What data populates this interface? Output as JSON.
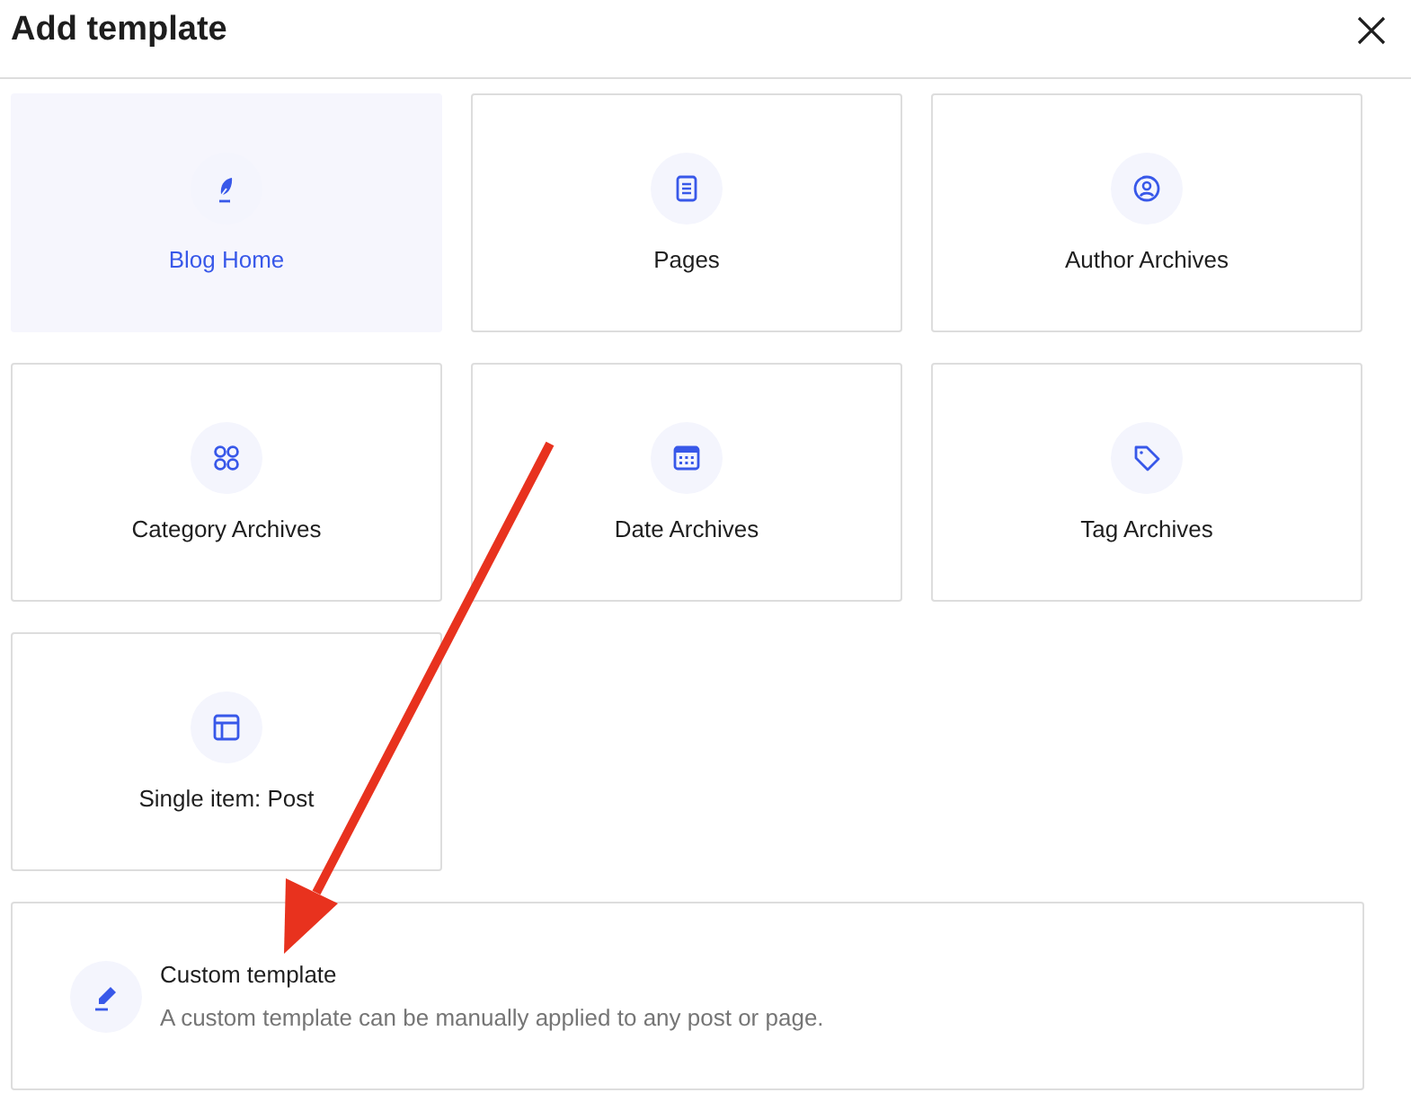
{
  "dialog": {
    "title": "Add template"
  },
  "templates": [
    {
      "label": "Blog Home",
      "selected": true
    },
    {
      "label": "Pages",
      "selected": false
    },
    {
      "label": "Author Archives",
      "selected": false
    },
    {
      "label": "Category Archives",
      "selected": false
    },
    {
      "label": "Date Archives",
      "selected": false
    },
    {
      "label": "Tag Archives",
      "selected": false
    },
    {
      "label": "Single item: Post",
      "selected": false
    }
  ],
  "custom_template": {
    "title": "Custom template",
    "description": "A custom template can be manually applied to any post or page."
  }
}
